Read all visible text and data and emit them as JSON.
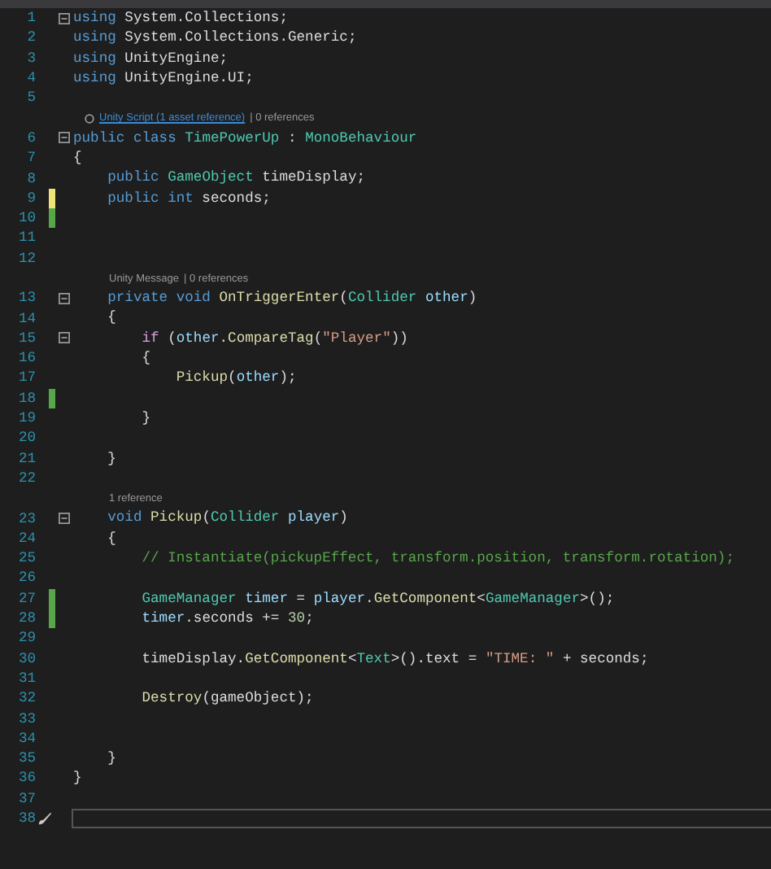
{
  "rows": [
    {
      "kind": "code",
      "number": "1",
      "edited": false,
      "fold": true,
      "tokens": [
        {
          "t": "using",
          "kind": "keyword"
        },
        {
          "t": " System.Collections;",
          "kind": "plain"
        }
      ]
    },
    {
      "kind": "code",
      "number": "2",
      "edited": false,
      "fold": false,
      "tokens": [
        {
          "t": "using",
          "kind": "keyword"
        },
        {
          "t": " System.Collections.Generic;",
          "kind": "plain"
        }
      ]
    },
    {
      "kind": "code",
      "number": "3",
      "edited": false,
      "fold": false,
      "tokens": [
        {
          "t": "using",
          "kind": "keyword"
        },
        {
          "t": " UnityEngine;",
          "kind": "plain"
        }
      ]
    },
    {
      "kind": "code",
      "number": "4",
      "edited": false,
      "fold": false,
      "tokens": [
        {
          "t": "using",
          "kind": "keyword"
        },
        {
          "t": " UnityEngine.UI;",
          "kind": "plain"
        }
      ]
    },
    {
      "kind": "code",
      "number": "5",
      "edited": false,
      "fold": false,
      "tokens": []
    },
    {
      "kind": "lens",
      "parts": [
        {
          "t": "Unity Script (1 asset reference)",
          "link": true
        },
        {
          "t": "| 0 references",
          "link": false
        }
      ]
    },
    {
      "kind": "code",
      "number": "6",
      "edited": false,
      "fold": true,
      "tokens": [
        {
          "t": "public class ",
          "kind": "keyword"
        },
        {
          "t": "TimePowerUp",
          "kind": "type"
        },
        {
          "t": " : ",
          "kind": "plain"
        },
        {
          "t": "MonoBehaviour",
          "kind": "type"
        }
      ]
    },
    {
      "kind": "code",
      "number": "7",
      "edited": false,
      "fold": false,
      "tokens": [
        {
          "t": "{",
          "kind": "plain"
        }
      ]
    },
    {
      "kind": "code",
      "number": "8",
      "edited": false,
      "fold": false,
      "tokens": [
        {
          "t": "    public ",
          "kind": "keyword"
        },
        {
          "t": "GameObject",
          "kind": "type"
        },
        {
          "t": " timeDisplay;",
          "kind": "plain"
        }
      ]
    },
    {
      "kind": "code",
      "number": "9",
      "edited": true,
      "saved": false,
      "fold": false,
      "tokens": [
        {
          "t": "    public int",
          "kind": "keyword"
        },
        {
          "t": " seconds;",
          "kind": "plain"
        }
      ]
    },
    {
      "kind": "code",
      "number": "10",
      "edited": true,
      "saved": true,
      "fold": false,
      "tokens": []
    },
    {
      "kind": "code",
      "number": "11",
      "edited": false,
      "fold": false,
      "tokens": []
    },
    {
      "kind": "code",
      "number": "12",
      "edited": false,
      "fold": false,
      "tokens": []
    },
    {
      "kind": "lens",
      "parts": [
        {
          "t": "Unity Message",
          "link": false
        },
        {
          "t": "| 0 references",
          "link": false
        }
      ]
    },
    {
      "kind": "code",
      "number": "13",
      "edited": false,
      "fold": true,
      "tokens": [
        {
          "t": "    private void ",
          "kind": "keyword"
        },
        {
          "t": "OnTriggerEnter",
          "kind": "method"
        },
        {
          "t": "(",
          "kind": "plain"
        },
        {
          "t": "Collider",
          "kind": "type"
        },
        {
          "t": " other",
          "kind": "param"
        },
        {
          "t": ")",
          "kind": "plain"
        }
      ]
    },
    {
      "kind": "code",
      "number": "14",
      "edited": false,
      "fold": false,
      "tokens": [
        {
          "t": "    {",
          "kind": "plain"
        }
      ]
    },
    {
      "kind": "code",
      "number": "15",
      "edited": false,
      "fold": true,
      "tokens": [
        {
          "t": "        if",
          "kind": "control"
        },
        {
          "t": " (",
          "kind": "plain"
        },
        {
          "t": "other",
          "kind": "param"
        },
        {
          "t": ".",
          "kind": "plain"
        },
        {
          "t": "CompareTag",
          "kind": "method"
        },
        {
          "t": "(",
          "kind": "plain"
        },
        {
          "t": "\"Player\"",
          "kind": "string"
        },
        {
          "t": "))",
          "kind": "plain"
        }
      ]
    },
    {
      "kind": "code",
      "number": "16",
      "edited": false,
      "fold": false,
      "tokens": [
        {
          "t": "        {",
          "kind": "plain"
        }
      ]
    },
    {
      "kind": "code",
      "number": "17",
      "edited": false,
      "fold": false,
      "tokens": [
        {
          "t": "            Pickup",
          "kind": "method"
        },
        {
          "t": "(",
          "kind": "plain"
        },
        {
          "t": "other",
          "kind": "param"
        },
        {
          "t": ");",
          "kind": "plain"
        }
      ]
    },
    {
      "kind": "code",
      "number": "18",
      "edited": true,
      "saved": true,
      "fold": false,
      "tokens": []
    },
    {
      "kind": "code",
      "number": "19",
      "edited": false,
      "fold": false,
      "tokens": [
        {
          "t": "        }",
          "kind": "plain"
        }
      ]
    },
    {
      "kind": "code",
      "number": "20",
      "edited": false,
      "fold": false,
      "tokens": []
    },
    {
      "kind": "code",
      "number": "21",
      "edited": false,
      "fold": false,
      "tokens": [
        {
          "t": "    }",
          "kind": "plain"
        }
      ]
    },
    {
      "kind": "code",
      "number": "22",
      "edited": false,
      "fold": false,
      "tokens": []
    },
    {
      "kind": "lens",
      "parts": [
        {
          "t": "1 reference",
          "link": false
        }
      ]
    },
    {
      "kind": "code",
      "number": "23",
      "edited": false,
      "fold": true,
      "tokens": [
        {
          "t": "    void ",
          "kind": "keyword"
        },
        {
          "t": "Pickup",
          "kind": "method"
        },
        {
          "t": "(",
          "kind": "plain"
        },
        {
          "t": "Collider",
          "kind": "type"
        },
        {
          "t": " player",
          "kind": "param"
        },
        {
          "t": ")",
          "kind": "plain"
        }
      ]
    },
    {
      "kind": "code",
      "number": "24",
      "edited": false,
      "fold": false,
      "tokens": [
        {
          "t": "    {",
          "kind": "plain"
        }
      ]
    },
    {
      "kind": "code",
      "number": "25",
      "edited": false,
      "fold": false,
      "tokens": [
        {
          "t": "        // Instantiate(pickupEffect, transform.position, transform.rotation);",
          "kind": "comment"
        }
      ]
    },
    {
      "kind": "code",
      "number": "26",
      "edited": false,
      "fold": false,
      "tokens": []
    },
    {
      "kind": "code",
      "number": "27",
      "edited": true,
      "saved": true,
      "fold": false,
      "tokens": [
        {
          "t": "        GameManager",
          "kind": "type"
        },
        {
          "t": " timer",
          "kind": "param"
        },
        {
          "t": " = ",
          "kind": "plain"
        },
        {
          "t": "player",
          "kind": "param"
        },
        {
          "t": ".",
          "kind": "plain"
        },
        {
          "t": "GetComponent",
          "kind": "method"
        },
        {
          "t": "<",
          "kind": "plain"
        },
        {
          "t": "GameManager",
          "kind": "type"
        },
        {
          "t": ">();",
          "kind": "plain"
        }
      ]
    },
    {
      "kind": "code",
      "number": "28",
      "edited": true,
      "saved": true,
      "fold": false,
      "tokens": [
        {
          "t": "        timer",
          "kind": "param"
        },
        {
          "t": ".seconds += ",
          "kind": "plain"
        },
        {
          "t": "30",
          "kind": "number"
        },
        {
          "t": ";",
          "kind": "plain"
        }
      ]
    },
    {
      "kind": "code",
      "number": "29",
      "edited": false,
      "fold": false,
      "tokens": []
    },
    {
      "kind": "code",
      "number": "30",
      "edited": false,
      "fold": false,
      "tokens": [
        {
          "t": "        timeDisplay.",
          "kind": "plain"
        },
        {
          "t": "GetComponent",
          "kind": "method"
        },
        {
          "t": "<",
          "kind": "plain"
        },
        {
          "t": "Text",
          "kind": "type"
        },
        {
          "t": ">().text = ",
          "kind": "plain"
        },
        {
          "t": "\"TIME: \"",
          "kind": "string"
        },
        {
          "t": " + seconds;",
          "kind": "plain"
        }
      ]
    },
    {
      "kind": "code",
      "number": "31",
      "edited": false,
      "fold": false,
      "tokens": []
    },
    {
      "kind": "code",
      "number": "32",
      "edited": false,
      "fold": false,
      "tokens": [
        {
          "t": "        Destroy",
          "kind": "method"
        },
        {
          "t": "(gameObject);",
          "kind": "plain"
        }
      ]
    },
    {
      "kind": "code",
      "number": "33",
      "edited": false,
      "fold": false,
      "tokens": []
    },
    {
      "kind": "code",
      "number": "34",
      "edited": false,
      "fold": false,
      "tokens": []
    },
    {
      "kind": "code",
      "number": "35",
      "edited": false,
      "fold": false,
      "tokens": [
        {
          "t": "    }",
          "kind": "plain"
        }
      ]
    },
    {
      "kind": "code",
      "number": "36",
      "edited": false,
      "fold": false,
      "tokens": [
        {
          "t": "}",
          "kind": "plain"
        }
      ]
    },
    {
      "kind": "code",
      "number": "37",
      "edited": false,
      "fold": false,
      "tokens": []
    },
    {
      "kind": "input",
      "number": "38"
    }
  ]
}
